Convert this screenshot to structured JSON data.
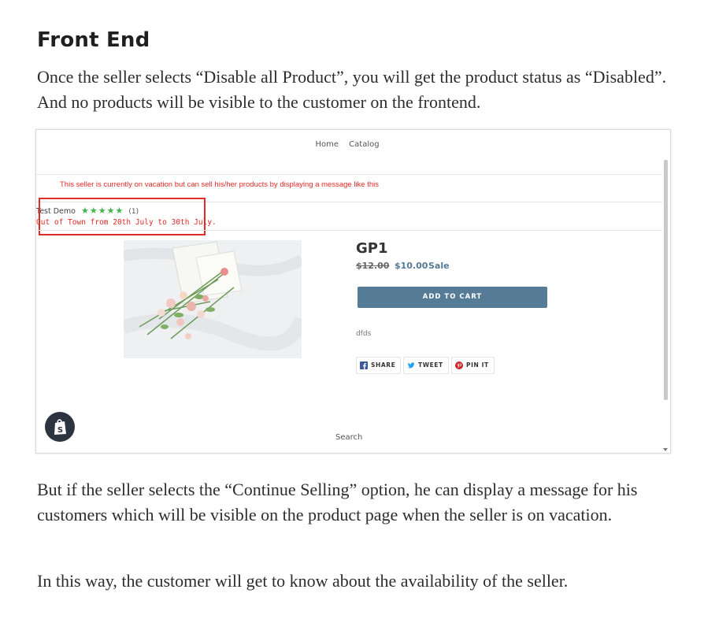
{
  "heading": "Front End",
  "paragraph1": "Once the seller selects “Disable all Product”, you will get the product status as “Disabled”. And no products will be visible to the customer on the frontend.",
  "screenshot": {
    "nav": {
      "home": "Home",
      "catalog": "Catalog"
    },
    "vacation_notice": "This seller is currently on vacation but can sell his/her products by displaying a message like this",
    "seller": {
      "name": "Test Demo",
      "stars": "★★★★★",
      "review_count": "(1)",
      "message": "Out of Town from 20th July to 30th July."
    },
    "product": {
      "title": "GP1",
      "price_old": "$12.00",
      "price_new": "$10.00",
      "sale_label": "Sale",
      "add_to_cart": "ADD TO CART",
      "description": "dfds"
    },
    "share": {
      "share": "SHARE",
      "tweet": "TWEET",
      "pin": "PIN IT"
    },
    "footer_search": "Search",
    "icons": [
      "facebook-icon",
      "twitter-icon",
      "pinterest-icon",
      "shopify-bag-icon"
    ],
    "colors": {
      "alert_red": "#e02b27",
      "button_blue": "#557b97",
      "star_green": "#3bb54a"
    }
  },
  "paragraph2": "But if the seller selects the “Continue Selling” option, he can display a message for his customers which will be visible on the product page when the seller is on vacation.",
  "paragraph3": "In this way, the customer will get to know about the availability of the seller."
}
